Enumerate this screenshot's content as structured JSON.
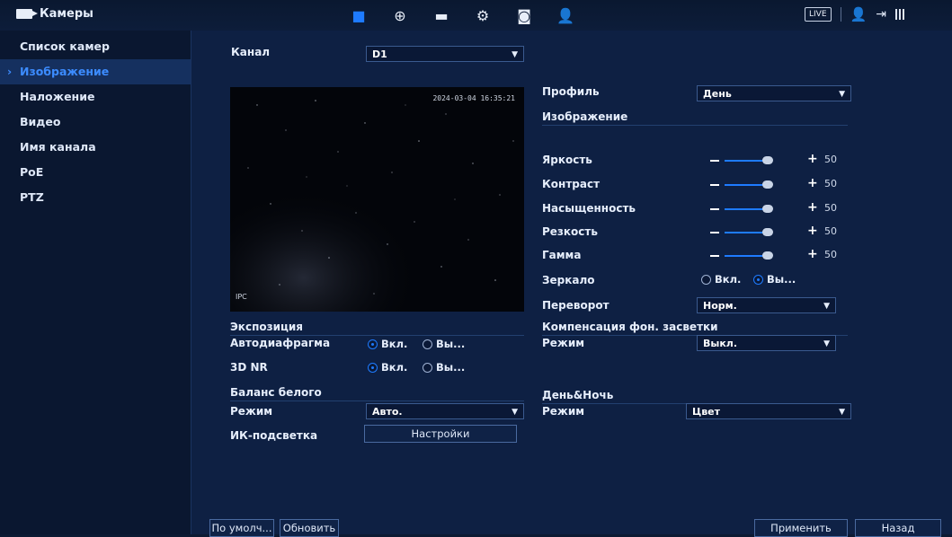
{
  "topbar": {
    "title": "Камеры",
    "live": "LIVE"
  },
  "sidebar": {
    "items": [
      {
        "label": "Список камер"
      },
      {
        "label": "Изображение"
      },
      {
        "label": "Наложение"
      },
      {
        "label": "Видео"
      },
      {
        "label": "Имя канала"
      },
      {
        "label": "PoE"
      },
      {
        "label": "PTZ"
      }
    ]
  },
  "main": {
    "channel_label": "Канал",
    "channel_value": "D1",
    "osd_date": "2024-03-04 16:35:21",
    "osd_name": "IPC",
    "profile_label": "Профиль",
    "profile_value": "День",
    "image_section": "Изображение",
    "sliders": [
      {
        "label": "Яркость",
        "value": "50"
      },
      {
        "label": "Контраст",
        "value": "50"
      },
      {
        "label": "Насыщенность",
        "value": "50"
      },
      {
        "label": "Резкость",
        "value": "50"
      },
      {
        "label": "Гамма",
        "value": "50"
      }
    ],
    "mirror_label": "Зеркало",
    "mirror_on": "Вкл.",
    "mirror_off": "Вы...",
    "flip_label": "Переворот",
    "flip_value": "Норм.",
    "exposure_section": "Экспозиция",
    "iris_label": "Автодиафрагма",
    "iris_on": "Вкл.",
    "iris_off": "Вы...",
    "nr_label": "3D NR",
    "nr_on": "Вкл.",
    "nr_off": "Вы...",
    "blc_section": "Компенсация фон. засветки",
    "blc_mode_label": "Режим",
    "blc_mode_value": "Выкл.",
    "wb_section": "Баланс белого",
    "wb_mode_label": "Режим",
    "wb_mode_value": "Авто.",
    "daynight_section": "День&Ночь",
    "dn_mode_label": "Режим",
    "dn_mode_value": "Цвет",
    "ir_label": "ИК-подсветка",
    "ir_button": "Настройки"
  },
  "footer": {
    "default": "По умолч...",
    "refresh": "Обновить",
    "apply": "Применить",
    "back": "Назад"
  }
}
